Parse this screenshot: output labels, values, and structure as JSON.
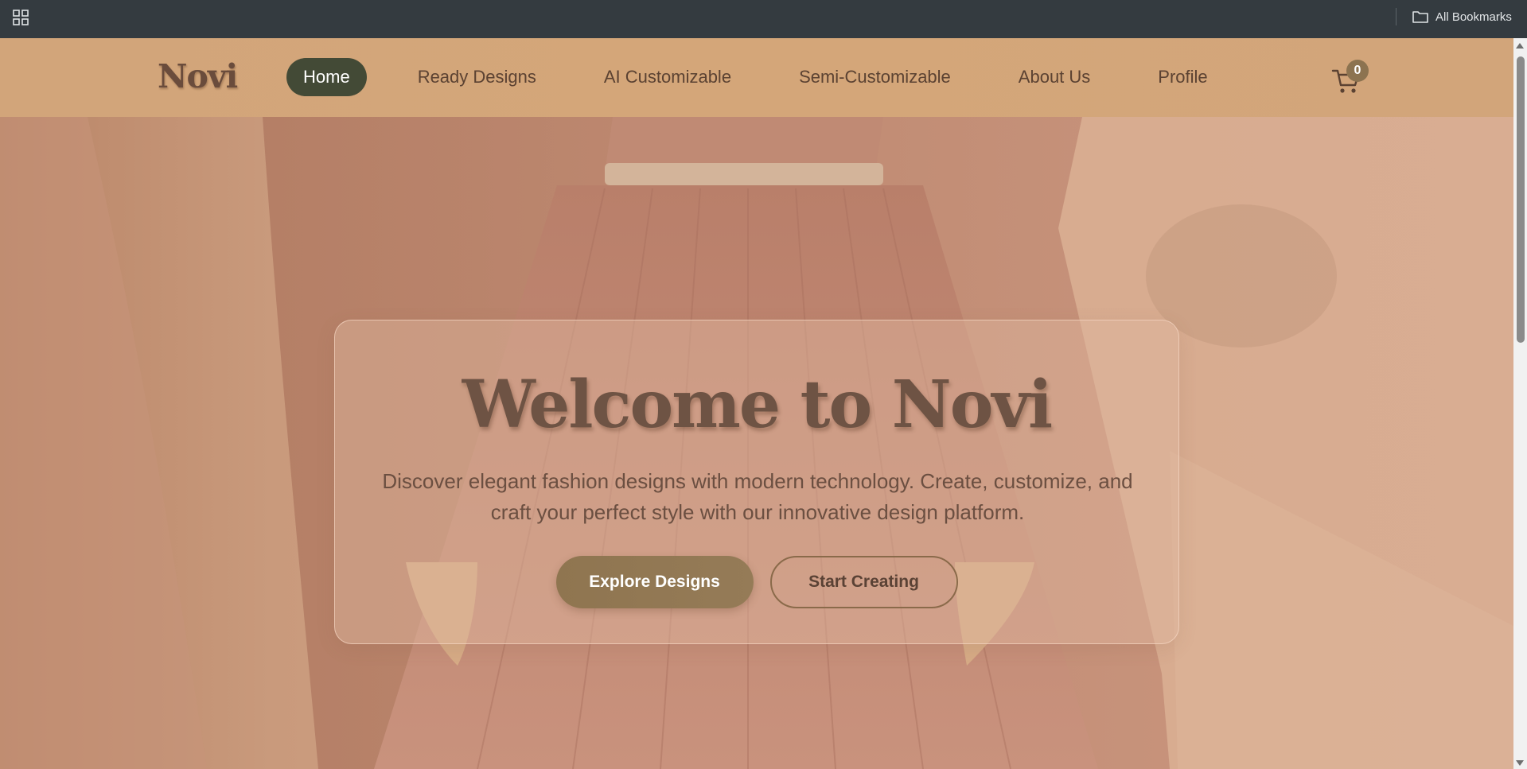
{
  "browser": {
    "bookmarks_label": "All Bookmarks",
    "apps_icon": "apps-grid-icon",
    "folder_icon": "folder-icon"
  },
  "nav": {
    "logo": "Novi",
    "links": [
      {
        "label": "Home",
        "active": true
      },
      {
        "label": "Ready Designs",
        "active": false
      },
      {
        "label": "AI Customizable",
        "active": false
      },
      {
        "label": "Semi-Customizable",
        "active": false
      },
      {
        "label": "About Us",
        "active": false
      },
      {
        "label": "Profile",
        "active": false
      }
    ],
    "cart_icon": "shopping-cart-icon",
    "cart_count": "0"
  },
  "hero": {
    "title": "Welcome to Novi",
    "subtitle": "Discover elegant fashion designs with modern technology. Create, customize, and craft your perfect style with our innovative design platform.",
    "primary_button": "Explore Designs",
    "secondary_button": "Start Creating"
  },
  "colors": {
    "nav_background": "#d3a67a",
    "active_nav": "#434a36",
    "primary_button": "#927852",
    "text_brown": "#6e5344",
    "browser_bar": "#343b40"
  }
}
